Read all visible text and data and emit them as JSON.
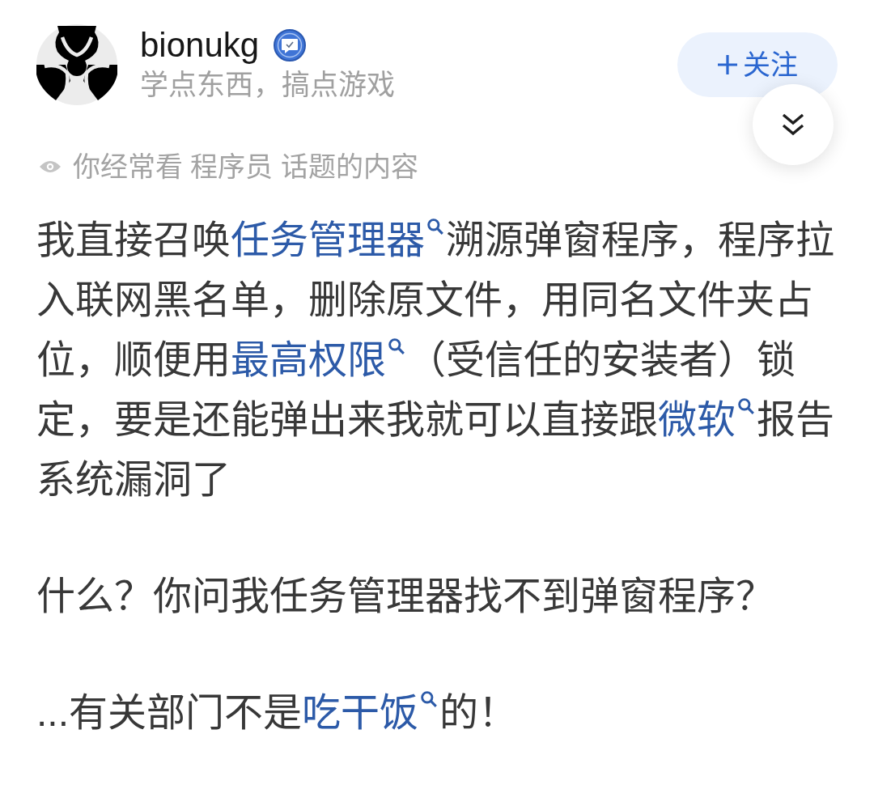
{
  "author": {
    "name": "bionukg",
    "verified": true,
    "bio": "学点东西，搞点游戏"
  },
  "follow_button": {
    "label": "关注"
  },
  "topic_hint": {
    "text": "你经常看 程序员 话题的内容"
  },
  "paragraphs": [
    [
      {
        "kind": "text",
        "text": "我直接召唤"
      },
      {
        "kind": "link",
        "text": "任务管理器"
      },
      {
        "kind": "text",
        "text": "溯源弹窗程序，程序拉入联网黑名单，删除原文件，用同名文件夹占位，顺便用"
      },
      {
        "kind": "link",
        "text": "最高权限"
      },
      {
        "kind": "text",
        "text": "（受信任的安装者）锁定，要是还能弹出来我就可以直接跟"
      },
      {
        "kind": "link",
        "text": "微软"
      },
      {
        "kind": "text",
        "text": "报告系统漏洞了"
      }
    ],
    [
      {
        "kind": "text",
        "text": "什么？你问我任务管理器找不到弹窗程序？"
      }
    ],
    [
      {
        "kind": "text",
        "text": "...有关部门不是"
      },
      {
        "kind": "link",
        "text": "吃干饭"
      },
      {
        "kind": "text",
        "text": "的！"
      }
    ]
  ]
}
